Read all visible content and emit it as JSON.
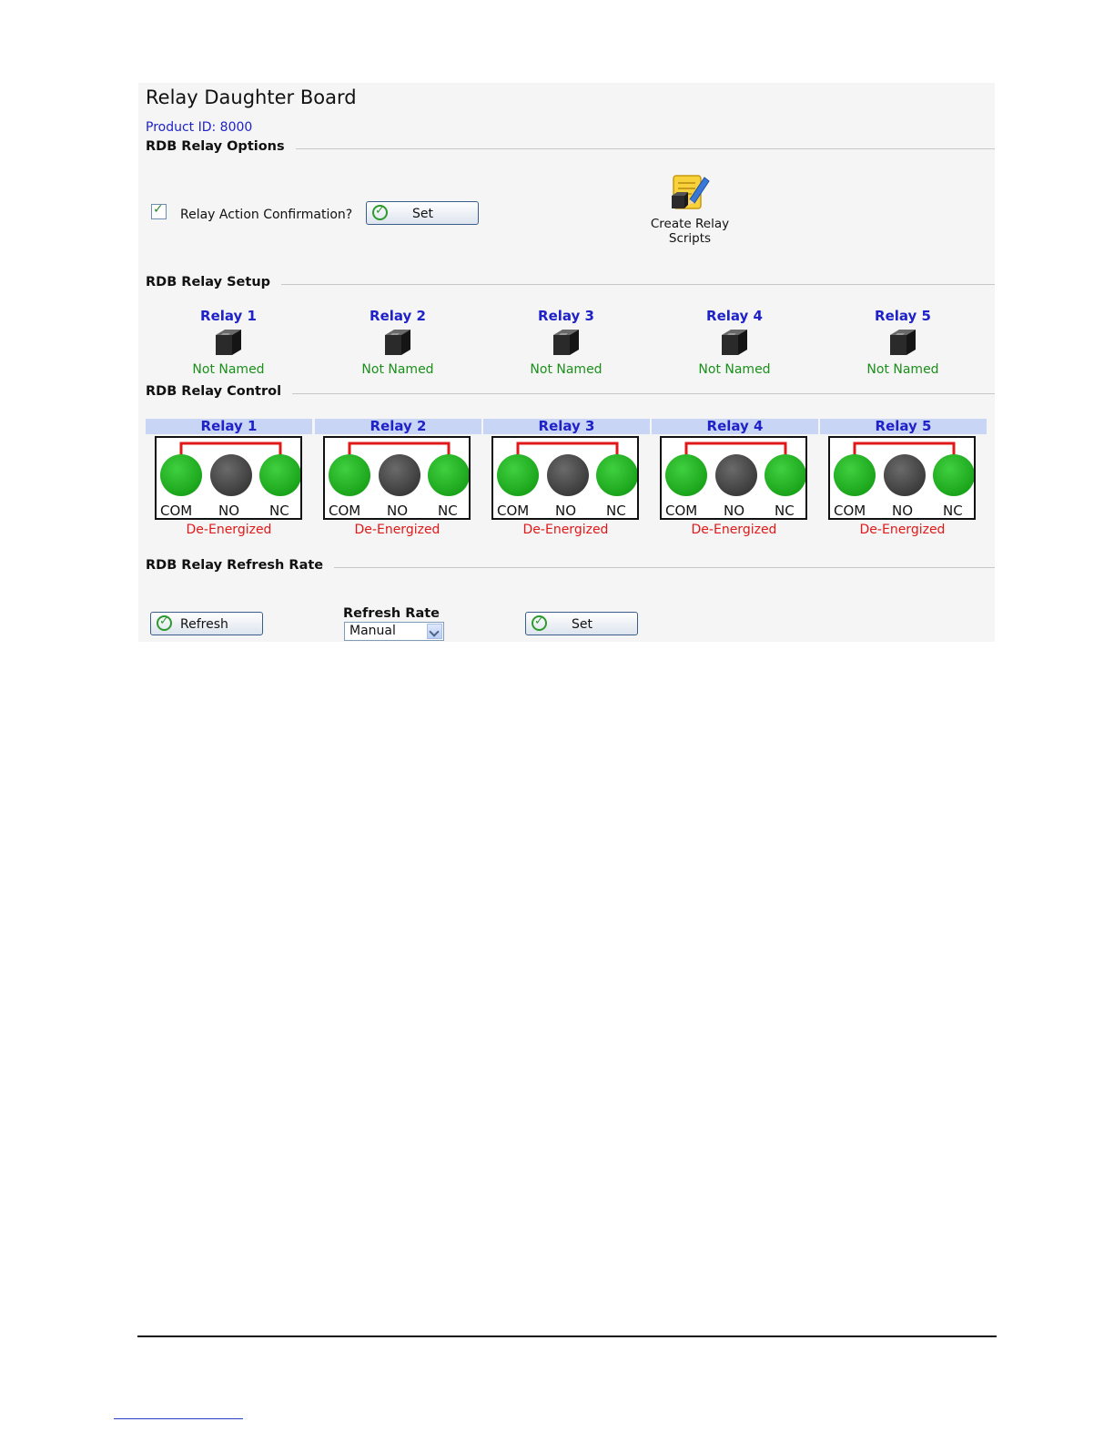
{
  "page": {
    "title": "Relay Daughter Board",
    "product_id": "Product ID: 8000"
  },
  "options": {
    "section_label": "RDB Relay Options",
    "confirm_checked": true,
    "confirm_label": "Relay Action Confirmation?",
    "set_label": "Set",
    "scripts_label_line1": "Create Relay",
    "scripts_label_line2": "Scripts"
  },
  "setup": {
    "section_label": "RDB Relay Setup",
    "relays": [
      {
        "name": "Relay 1",
        "status": "Not Named"
      },
      {
        "name": "Relay 2",
        "status": "Not Named"
      },
      {
        "name": "Relay 3",
        "status": "Not Named"
      },
      {
        "name": "Relay 4",
        "status": "Not Named"
      },
      {
        "name": "Relay 5",
        "status": "Not Named"
      }
    ]
  },
  "control": {
    "section_label": "RDB Relay Control",
    "terminal_labels": [
      "COM",
      "NO",
      "NC"
    ],
    "relays": [
      {
        "name": "Relay 1",
        "state": "De-Energized"
      },
      {
        "name": "Relay 2",
        "state": "De-Energized"
      },
      {
        "name": "Relay 3",
        "state": "De-Energized"
      },
      {
        "name": "Relay 4",
        "state": "De-Energized"
      },
      {
        "name": "Relay 5",
        "state": "De-Energized"
      }
    ],
    "colors": {
      "active": "#1aa31a",
      "inactive": "#3a3a3a",
      "link": "#e01818",
      "status": "#e01818"
    }
  },
  "refresh": {
    "section_label": "RDB Relay Refresh Rate",
    "refresh_label": "Refresh",
    "rate_label": "Refresh Rate",
    "rate_value": "Manual",
    "set_label": "Set"
  }
}
